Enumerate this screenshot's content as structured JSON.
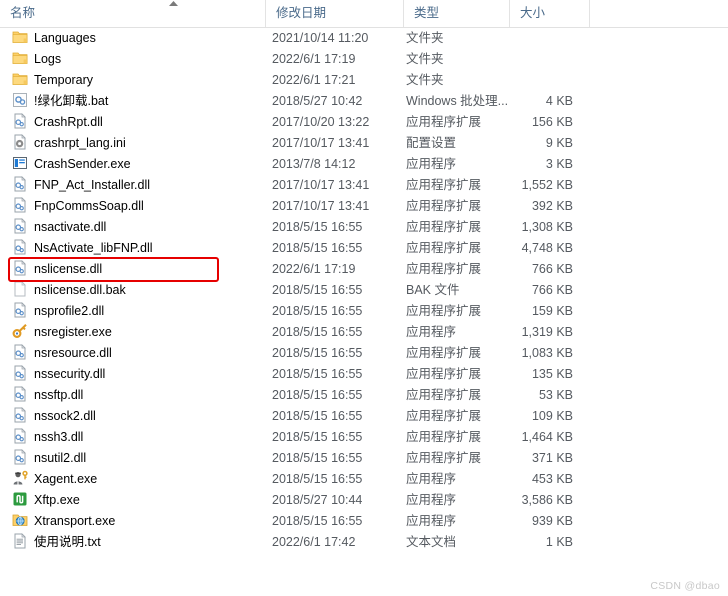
{
  "window": {
    "title": "File Explorer file listing"
  },
  "columns": {
    "name": "名称",
    "date": "修改日期",
    "type": "类型",
    "size": "大小",
    "sort_indicator": "︿"
  },
  "annotation": {
    "highlight_color": "#e60000",
    "highlighted_file": "nslicense.dll"
  },
  "watermark": {
    "text": "CSDN @dbao"
  },
  "rows": [
    {
      "icon": "folder-icon",
      "name": "Languages",
      "date": "2021/10/14 11:20",
      "type": "文件夹",
      "size": ""
    },
    {
      "icon": "folder-icon",
      "name": "Logs",
      "date": "2022/6/1 17:19",
      "type": "文件夹",
      "size": ""
    },
    {
      "icon": "folder-icon",
      "name": "Temporary",
      "date": "2022/6/1 17:21",
      "type": "文件夹",
      "size": ""
    },
    {
      "icon": "batch-file-icon",
      "name": "!绿化卸载.bat",
      "date": "2018/5/27 10:42",
      "type": "Windows 批处理...",
      "size": "4 KB"
    },
    {
      "icon": "dll-file-icon",
      "name": "CrashRpt.dll",
      "date": "2017/10/20 13:22",
      "type": "应用程序扩展",
      "size": "156 KB"
    },
    {
      "icon": "ini-file-icon",
      "name": "crashrpt_lang.ini",
      "date": "2017/10/17 13:41",
      "type": "配置设置",
      "size": "9 KB"
    },
    {
      "icon": "application-icon",
      "name": "CrashSender.exe",
      "date": "2013/7/8 14:12",
      "type": "应用程序",
      "size": "3 KB"
    },
    {
      "icon": "dll-file-icon",
      "name": "FNP_Act_Installer.dll",
      "date": "2017/10/17 13:41",
      "type": "应用程序扩展",
      "size": "1,552 KB"
    },
    {
      "icon": "dll-file-icon",
      "name": "FnpCommsSoap.dll",
      "date": "2017/10/17 13:41",
      "type": "应用程序扩展",
      "size": "392 KB"
    },
    {
      "icon": "dll-file-icon",
      "name": "nsactivate.dll",
      "date": "2018/5/15 16:55",
      "type": "应用程序扩展",
      "size": "1,308 KB"
    },
    {
      "icon": "dll-file-icon",
      "name": "NsActivate_libFNP.dll",
      "date": "2018/5/15 16:55",
      "type": "应用程序扩展",
      "size": "4,748 KB"
    },
    {
      "icon": "dll-file-icon",
      "name": "nslicense.dll",
      "date": "2022/6/1 17:19",
      "type": "应用程序扩展",
      "size": "766 KB"
    },
    {
      "icon": "blank-file-icon",
      "name": "nslicense.dll.bak",
      "date": "2018/5/15 16:55",
      "type": "BAK 文件",
      "size": "766 KB"
    },
    {
      "icon": "dll-file-icon",
      "name": "nsprofile2.dll",
      "date": "2018/5/15 16:55",
      "type": "应用程序扩展",
      "size": "159 KB"
    },
    {
      "icon": "key-icon",
      "name": "nsregister.exe",
      "date": "2018/5/15 16:55",
      "type": "应用程序",
      "size": "1,319 KB"
    },
    {
      "icon": "dll-file-icon",
      "name": "nsresource.dll",
      "date": "2018/5/15 16:55",
      "type": "应用程序扩展",
      "size": "1,083 KB"
    },
    {
      "icon": "dll-file-icon",
      "name": "nssecurity.dll",
      "date": "2018/5/15 16:55",
      "type": "应用程序扩展",
      "size": "135 KB"
    },
    {
      "icon": "dll-file-icon",
      "name": "nssftp.dll",
      "date": "2018/5/15 16:55",
      "type": "应用程序扩展",
      "size": "53 KB"
    },
    {
      "icon": "dll-file-icon",
      "name": "nssock2.dll",
      "date": "2018/5/15 16:55",
      "type": "应用程序扩展",
      "size": "109 KB"
    },
    {
      "icon": "dll-file-icon",
      "name": "nssh3.dll",
      "date": "2018/5/15 16:55",
      "type": "应用程序扩展",
      "size": "1,464 KB"
    },
    {
      "icon": "dll-file-icon",
      "name": "nsutil2.dll",
      "date": "2018/5/15 16:55",
      "type": "应用程序扩展",
      "size": "371 KB"
    },
    {
      "icon": "agent-icon",
      "name": "Xagent.exe",
      "date": "2018/5/15 16:55",
      "type": "应用程序",
      "size": "453 KB"
    },
    {
      "icon": "xftp-icon",
      "name": "Xftp.exe",
      "date": "2018/5/27 10:44",
      "type": "应用程序",
      "size": "3,586 KB"
    },
    {
      "icon": "xtransport-icon",
      "name": "Xtransport.exe",
      "date": "2018/5/15 16:55",
      "type": "应用程序",
      "size": "939 KB"
    },
    {
      "icon": "text-file-icon",
      "name": "使用说明.txt",
      "date": "2022/6/1 17:42",
      "type": "文本文档",
      "size": "1 KB"
    }
  ]
}
